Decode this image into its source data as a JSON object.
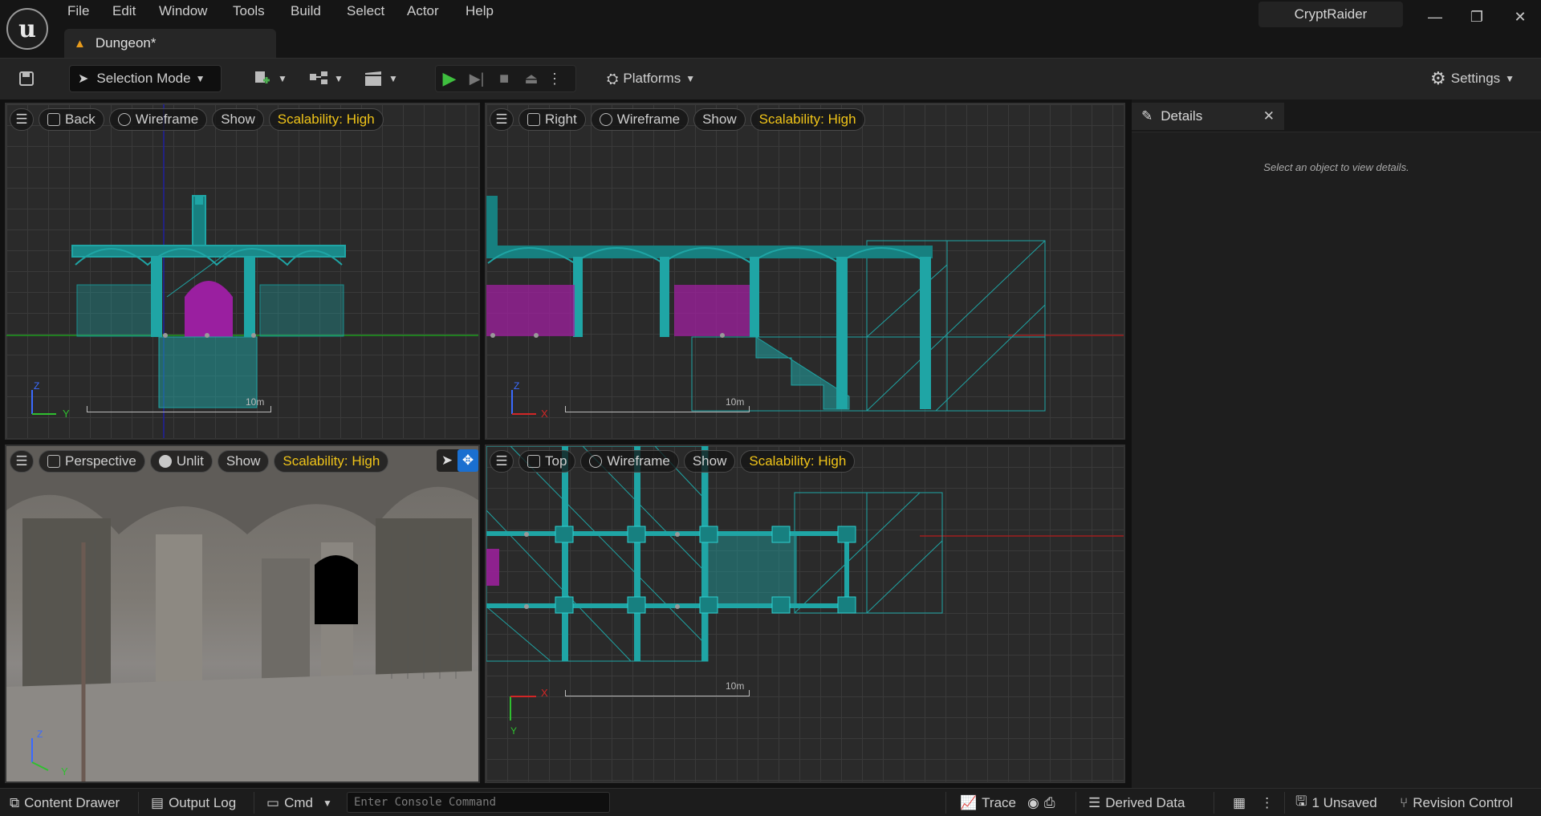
{
  "app": {
    "logo_letter": "u",
    "project": "CryptRaider"
  },
  "menu": [
    "File",
    "Edit",
    "Window",
    "Tools",
    "Build",
    "Select",
    "Actor",
    "Help"
  ],
  "window_controls": {
    "minimize": "—",
    "restore": "❐",
    "close": "✕"
  },
  "document_tab": {
    "label": "Dungeon*",
    "warn_icon": "warning-icon"
  },
  "toolbar": {
    "selection_mode": "Selection Mode",
    "platforms": "Platforms",
    "settings": "Settings"
  },
  "viewports": {
    "back": {
      "view": "Back",
      "mode": "Wireframe",
      "show": "Show",
      "scalability": "Scalability: High",
      "scale": "10m",
      "axis_v": "Z",
      "axis_h": "Y"
    },
    "right": {
      "view": "Right",
      "mode": "Wireframe",
      "show": "Show",
      "scalability": "Scalability: High",
      "scale": "10m",
      "axis_v": "Z",
      "axis_h": "X"
    },
    "perspective": {
      "view": "Perspective",
      "mode": "Unlit",
      "show": "Show",
      "scalability": "Scalability: High",
      "axis_v": "Z",
      "axis_h": "Y"
    },
    "top": {
      "view": "Top",
      "mode": "Wireframe",
      "show": "Show",
      "scalability": "Scalability: High",
      "scale": "10m",
      "axis_v": "Y",
      "axis_h": "X"
    }
  },
  "details": {
    "tab": "Details",
    "hint": "Select an object to view details."
  },
  "statusbar": {
    "content_drawer": "Content Drawer",
    "output_log": "Output Log",
    "cmd": "Cmd",
    "console_placeholder": "Enter Console Command",
    "trace": "Trace",
    "derived_data": "Derived Data",
    "unsaved": "1 Unsaved",
    "revision_control": "Revision Control"
  },
  "colors": {
    "wire": "#1fa5a5",
    "door": "#a020a0",
    "accent": "#f0c419"
  }
}
